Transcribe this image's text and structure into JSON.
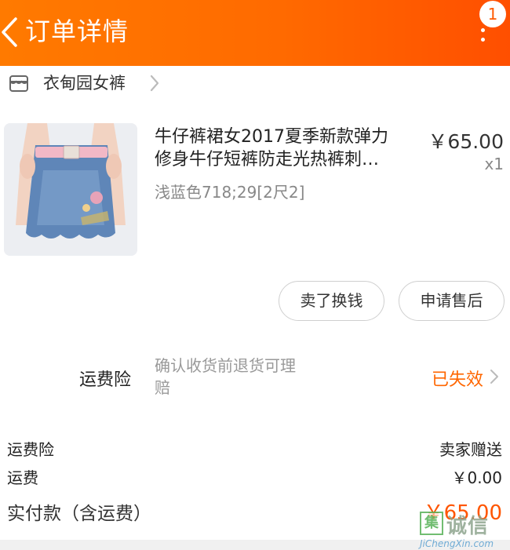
{
  "header": {
    "title": "订单详情",
    "badge_count": "1",
    "back_icon": "chevron-left-icon",
    "more_icon": "more-vertical-icon",
    "bg_start": "#ff7a00",
    "bg_end": "#ff4f00"
  },
  "shop": {
    "name": "衣甸园女裤",
    "icon": "store-icon"
  },
  "product": {
    "title_line1": "牛仔裤裙女2017夏季新款弹力",
    "title_line2": "修身牛仔短裤防走光热裤刺…",
    "variant": "浅蓝色718;29[2尺2]",
    "price": "￥65.00",
    "quantity": "x1"
  },
  "actions": {
    "sell_label": "卖了换钱",
    "after_sale_label": "申请售后"
  },
  "insurance": {
    "label": "运费险",
    "desc_line1": "确认收货前退货可理",
    "desc_line2": "赔",
    "status": "已失效",
    "status_color": "#ff6600"
  },
  "summary": {
    "rows": [
      {
        "label": "运费险",
        "value": "卖家赠送"
      },
      {
        "label": "运费",
        "value": "￥0.00"
      }
    ],
    "paid_label": "实付款（含运费）",
    "paid_value": "￥65.00",
    "accent": "#ff5500"
  },
  "watermark": {
    "box_char": "集",
    "text": "诚信",
    "url": "JiChengXin.com"
  }
}
